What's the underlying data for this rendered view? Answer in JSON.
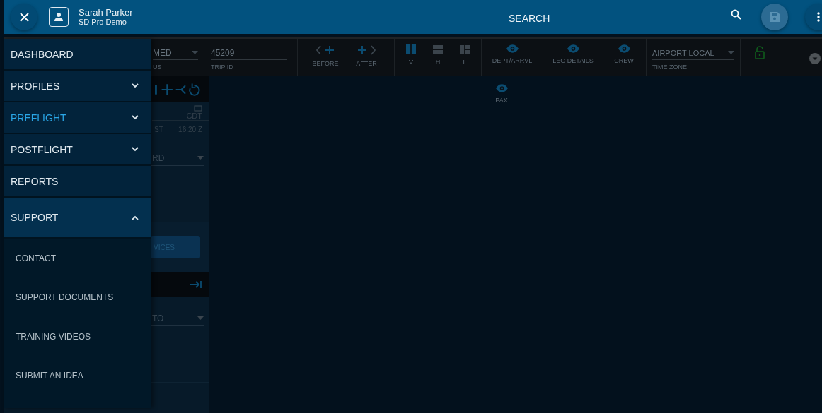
{
  "top_bar": {
    "user_name": "Sarah Parker",
    "user_org": "SD Pro Demo",
    "search": {
      "placeholder": "SEARCH"
    },
    "save_disabled": true
  },
  "toolbar": {
    "status": {
      "value": "MED",
      "label": "US"
    },
    "trip_id": {
      "value": "45209",
      "label": "TRIP ID"
    },
    "insert_buttons": [
      {
        "label": "BEFORE",
        "kind": "before"
      },
      {
        "label": "AFTER",
        "kind": "after"
      }
    ],
    "layouts": [
      {
        "label": "V",
        "kind": "vertical",
        "selected": true
      },
      {
        "label": "H",
        "kind": "horizontal",
        "selected": false
      },
      {
        "label": "L",
        "kind": "grid",
        "selected": false
      }
    ],
    "panels": [
      {
        "label": "DEPT/ARRVL",
        "visible": true
      },
      {
        "label": "LEG DETAILS",
        "visible": true
      },
      {
        "label": "CREW",
        "visible": true
      },
      {
        "label": "PAX",
        "visible": true
      }
    ],
    "time_zone": {
      "value": "AIRPORT LOCAL",
      "label": "TIME ZONE"
    },
    "locked": false
  },
  "side_panel": {
    "zone": "CDT",
    "time_label": "ST",
    "time_value": "16:20 Z",
    "field_1": "RD",
    "button": "VICES",
    "field_2": "TO"
  },
  "menu": {
    "items": [
      {
        "label": "DASHBOARD",
        "kind": "link",
        "selected": false
      },
      {
        "label": "PROFILES",
        "kind": "group",
        "selected": false,
        "expanded": false
      },
      {
        "label": "PREFLIGHT",
        "kind": "group",
        "selected": true,
        "expanded": false
      },
      {
        "label": "POSTFLIGHT",
        "kind": "group",
        "selected": false,
        "expanded": false
      },
      {
        "label": "REPORTS",
        "kind": "link",
        "selected": false
      },
      {
        "label": "SUPPORT",
        "kind": "group",
        "selected": false,
        "expanded": true,
        "children": [
          {
            "label": "CONTACT"
          },
          {
            "label": "SUPPORT DOCUMENTS"
          },
          {
            "label": "TRAINING VIDEOS"
          },
          {
            "label": "SUBMIT AN IDEA"
          }
        ]
      }
    ]
  }
}
